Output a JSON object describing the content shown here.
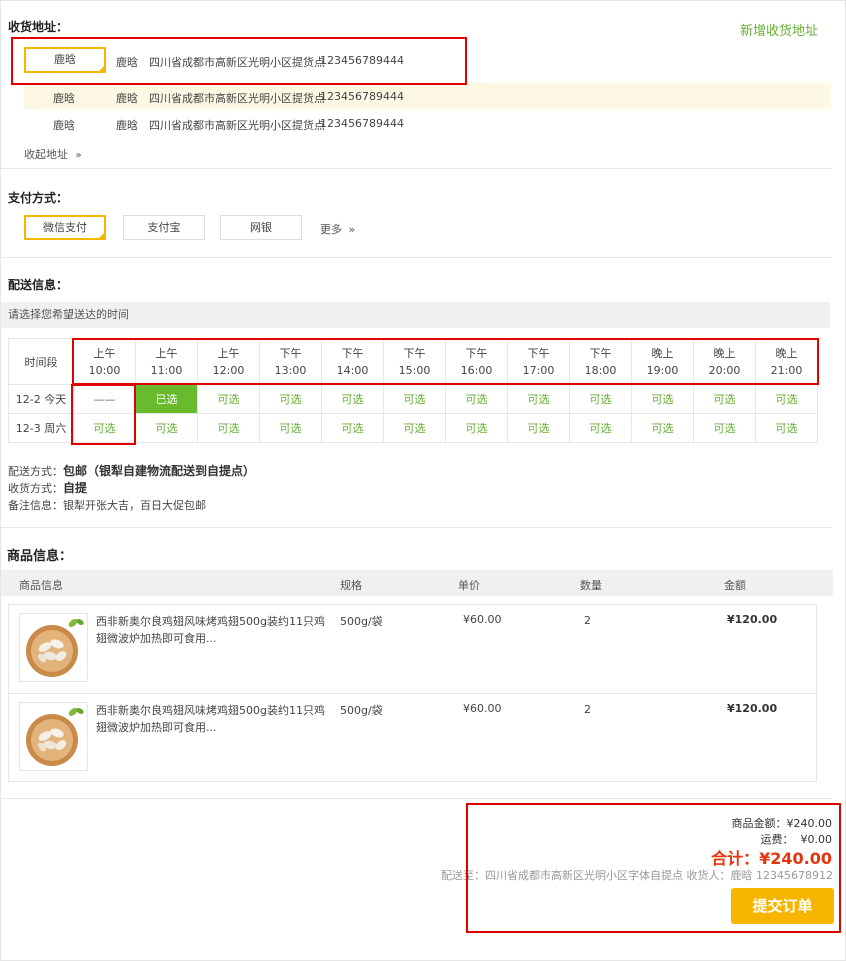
{
  "address": {
    "title": "收货地址：",
    "new_label": "新增收货地址",
    "rows": [
      {
        "name": "鹿晗",
        "receiver": "鹿晗",
        "address": "四川省成都市高新区光明小区提货点",
        "phone": "123456789444"
      },
      {
        "name": "鹿晗",
        "receiver": "鹿晗",
        "address": "四川省成都市高新区光明小区提货点",
        "phone": "123456789444"
      },
      {
        "name": "鹿晗",
        "receiver": "鹿晗",
        "address": "四川省成都市高新区光明小区提货点",
        "phone": "123456789444"
      }
    ],
    "collapse_label": "收起地址",
    "collapse_icon": "double-chevron-down"
  },
  "payment": {
    "title": "支付方式：",
    "options": [
      "微信支付",
      "支付宝",
      "网银"
    ],
    "more_label": "更多",
    "more_icon": "double-chevron-right"
  },
  "delivery": {
    "title": "配送信息：",
    "hint": "请选择您希望送达的时间",
    "time_label": "时间段",
    "slots": [
      {
        "period": "上午",
        "time": "10:00"
      },
      {
        "period": "上午",
        "time": "11:00"
      },
      {
        "period": "上午",
        "time": "12:00"
      },
      {
        "period": "下午",
        "time": "13:00"
      },
      {
        "period": "下午",
        "time": "14:00"
      },
      {
        "period": "下午",
        "time": "15:00"
      },
      {
        "period": "下午",
        "time": "16:00"
      },
      {
        "period": "下午",
        "time": "17:00"
      },
      {
        "period": "下午",
        "time": "18:00"
      },
      {
        "period": "晚上",
        "time": "19:00"
      },
      {
        "period": "晚上",
        "time": "20:00"
      },
      {
        "period": "晚上",
        "time": "21:00"
      }
    ],
    "days": [
      {
        "label": "12-2 今天",
        "cells": [
          "——",
          "已选",
          "可选",
          "可选",
          "可选",
          "可选",
          "可选",
          "可选",
          "可选",
          "可选",
          "可选",
          "可选"
        ]
      },
      {
        "label": "12-3 周六",
        "cells": [
          "可选",
          "可选",
          "可选",
          "可选",
          "可选",
          "可选",
          "可选",
          "可选",
          "可选",
          "可选",
          "可选",
          "可选"
        ]
      }
    ],
    "method_label": "配送方式：",
    "method_value": "包邮（银犁自建物流配送到自提点）",
    "receive_label": "收货方式：",
    "receive_value": "自提",
    "note_label": "备注信息：",
    "note_value": "银犁开张大吉，百日大促包邮"
  },
  "goods": {
    "title": "商品信息：",
    "headers": [
      "商品信息",
      "规格",
      "单价",
      "数量",
      "金额"
    ],
    "items": [
      {
        "name": "西非新奥尔良鸡翅风味烤鸡翅500g装约11只鸡翅微波炉加热即可食用...",
        "spec": "500g/袋",
        "price": "¥60.00",
        "qty": "2",
        "amount": "¥120.00"
      },
      {
        "name": "西非新奥尔良鸡翅风味烤鸡翅500g装约11只鸡翅微波炉加热即可食用...",
        "spec": "500g/袋",
        "price": "¥60.00",
        "qty": "2",
        "amount": "¥120.00"
      }
    ]
  },
  "summary": {
    "goods_amount": "商品金额：¥240.00",
    "freight": "运费：  ¥0.00",
    "total": "合计：¥240.00",
    "ship_to": "配送至：四川省成都市高新区光明小区字体自提点   收货人：鹿晗 12345678912",
    "submit_label": "提交订单"
  },
  "colors": {
    "accent_yellow": "#f7b500",
    "green": "#66b032",
    "red_total": "#e8340c",
    "highlight_box": "#e00000"
  }
}
